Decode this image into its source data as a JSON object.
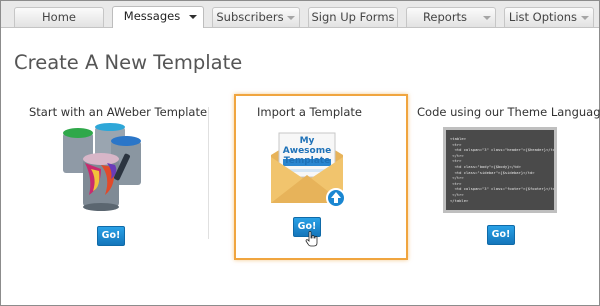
{
  "tabs": [
    {
      "label": "Home",
      "active": false,
      "dropdown": false
    },
    {
      "label": "Messages",
      "active": true,
      "dropdown": true
    },
    {
      "label": "Subscribers",
      "active": false,
      "dropdown": true
    },
    {
      "label": "Sign Up Forms",
      "active": false,
      "dropdown": false
    },
    {
      "label": "Reports",
      "active": false,
      "dropdown": true
    },
    {
      "label": "List Options",
      "active": false,
      "dropdown": true
    }
  ],
  "page_title": "Create A New Template",
  "columns": [
    {
      "title": "Start with an AWeber Template",
      "button": "Go!",
      "icon": "paint-cans-icon"
    },
    {
      "title": "Import a Template",
      "button": "Go!",
      "icon": "envelope-upload-icon",
      "highlighted": true,
      "envelope_card_text": "My Awesome Template"
    },
    {
      "title": "Code using our Theme Language",
      "button": "Go!",
      "icon": "code-screen-icon"
    }
  ],
  "code_lines": [
    "<table>",
    " <tr>",
    "  <td colspan=\"3\" class=\"header\">{$header}</td>",
    " </tr>",
    " <tr>",
    "  <td class=\"body\">{$body}</td>",
    "  <td class=\"sidebar\">{$sidebar}</td>",
    " </tr>",
    " <tr>",
    "  <td colspan=\"3\" class=\"footer\">{$footer}</td>",
    " </tr>",
    "</table>"
  ],
  "colors": {
    "accent": "#1b86d1",
    "highlight": "#f0a53f",
    "tab_bg": "#e9e9e9"
  }
}
